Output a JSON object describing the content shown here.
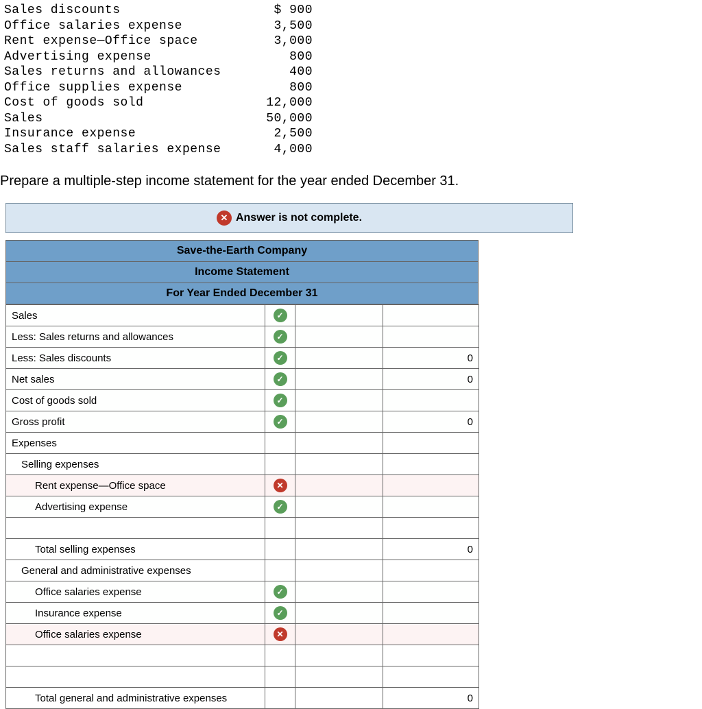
{
  "ledger": [
    {
      "label": "Sales discounts",
      "value": "$ 900"
    },
    {
      "label": "Office salaries expense",
      "value": "3,500"
    },
    {
      "label": "Rent expense—Office space",
      "value": "3,000"
    },
    {
      "label": "Advertising expense",
      "value": "800"
    },
    {
      "label": "Sales returns and allowances",
      "value": "400"
    },
    {
      "label": "Office supplies expense",
      "value": "800"
    },
    {
      "label": "Cost of goods sold",
      "value": "12,000"
    },
    {
      "label": "Sales",
      "value": "50,000"
    },
    {
      "label": "Insurance expense",
      "value": "2,500"
    },
    {
      "label": "Sales staff salaries expense",
      "value": "4,000"
    }
  ],
  "instruction": "Prepare a multiple-step income statement for the year ended December 31.",
  "status_message": "Answer is not complete.",
  "header": {
    "company": "Save-the-Earth Company",
    "title": "Income Statement",
    "period": "For Year Ended December 31"
  },
  "rows": [
    {
      "label": "Sales",
      "indent": 0,
      "status": "correct",
      "amt1": "",
      "amt2": ""
    },
    {
      "label": "Less: Sales returns and allowances",
      "indent": 0,
      "status": "correct",
      "amt1": "",
      "amt2": ""
    },
    {
      "label": "Less: Sales discounts",
      "indent": 0,
      "status": "correct",
      "amt1": "",
      "amt2": "0"
    },
    {
      "label": "Net sales",
      "indent": 0,
      "status": "correct",
      "amt1": "",
      "amt2": "0"
    },
    {
      "label": "Cost of goods sold",
      "indent": 0,
      "status": "correct",
      "amt1": "",
      "amt2": ""
    },
    {
      "label": "Gross profit",
      "indent": 0,
      "status": "correct",
      "amt1": "",
      "amt2": "0"
    },
    {
      "label": "Expenses",
      "indent": 0,
      "status": "none",
      "amt1": "",
      "amt2": ""
    },
    {
      "label": "Selling expenses",
      "indent": 1,
      "status": "none",
      "amt1": "",
      "amt2": ""
    },
    {
      "label": "Rent expense—Office space",
      "indent": 2,
      "status": "wrong",
      "amt1": "",
      "amt2": ""
    },
    {
      "label": "Advertising expense",
      "indent": 2,
      "status": "correct",
      "amt1": "",
      "amt2": ""
    },
    {
      "label": "",
      "indent": 0,
      "status": "none",
      "amt1": "",
      "amt2": ""
    },
    {
      "label": "Total selling expenses",
      "indent": 2,
      "status": "none",
      "amt1": "",
      "amt2": "0"
    },
    {
      "label": "General and administrative expenses",
      "indent": 1,
      "status": "none",
      "amt1": "",
      "amt2": ""
    },
    {
      "label": "Office salaries expense",
      "indent": 2,
      "status": "correct",
      "amt1": "",
      "amt2": ""
    },
    {
      "label": "Insurance expense",
      "indent": 2,
      "status": "correct",
      "amt1": "",
      "amt2": ""
    },
    {
      "label": "Office salaries expense",
      "indent": 2,
      "status": "wrong",
      "amt1": "",
      "amt2": ""
    },
    {
      "label": "",
      "indent": 0,
      "status": "none",
      "amt1": "",
      "amt2": ""
    },
    {
      "label": "",
      "indent": 0,
      "status": "none",
      "amt1": "",
      "amt2": ""
    },
    {
      "label": "Total general and administrative expenses",
      "indent": 2,
      "status": "none",
      "amt1": "",
      "amt2": "0"
    }
  ]
}
